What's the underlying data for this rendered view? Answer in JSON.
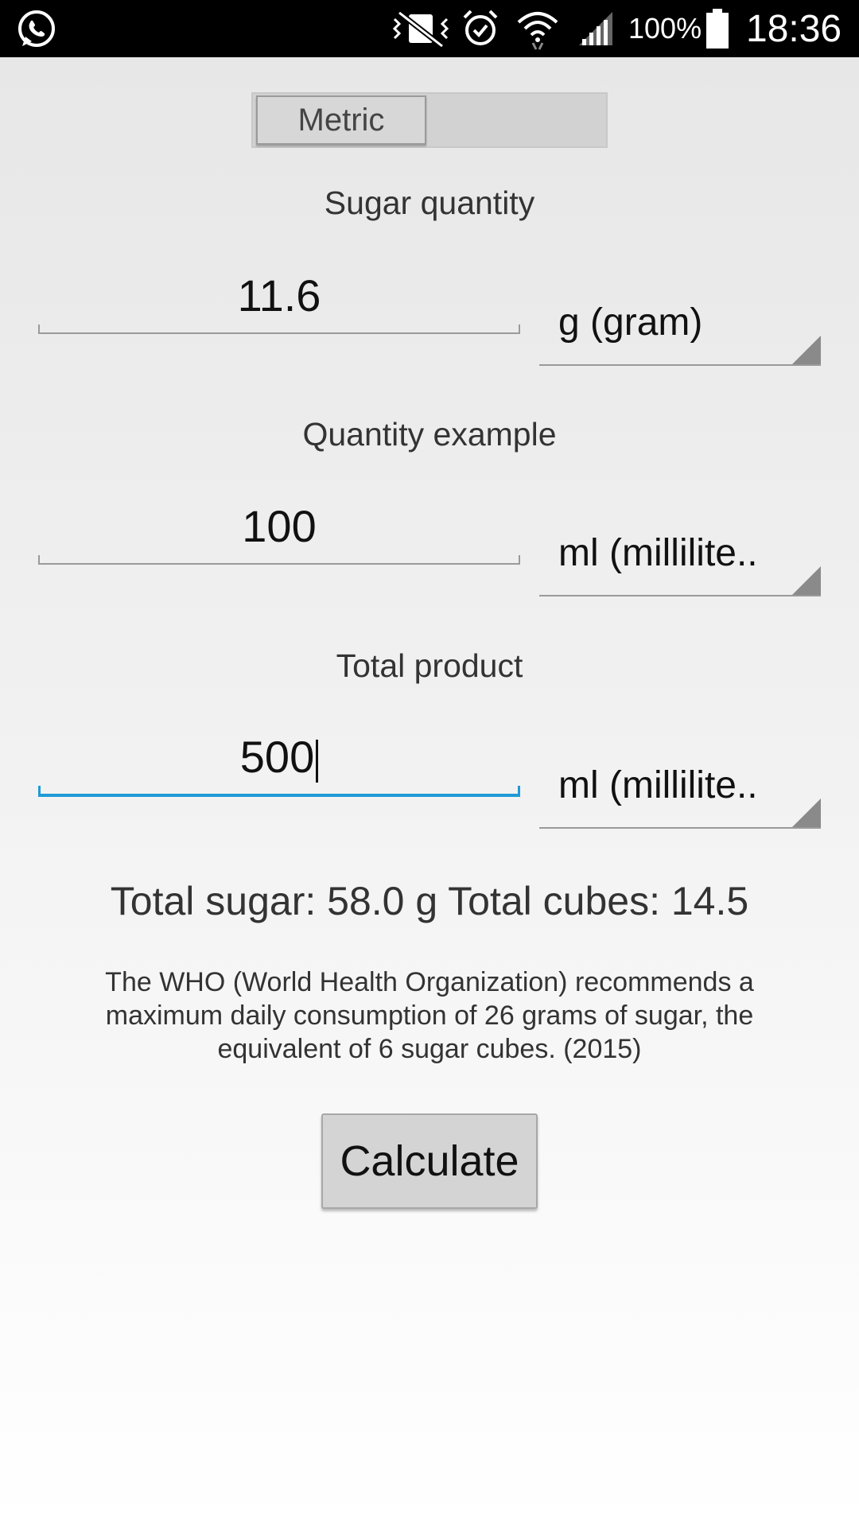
{
  "status_bar": {
    "icons": [
      "whatsapp-icon",
      "vibrate-mute-icon",
      "alarm-icon",
      "wifi-icon",
      "signal-icon",
      "battery-icon"
    ],
    "battery_text": "100%",
    "time": "18:36"
  },
  "toggle": {
    "label": "Metric"
  },
  "sugar": {
    "label": "Sugar quantity",
    "value": "11.6",
    "unit": "g (gram)"
  },
  "example": {
    "label": "Quantity example",
    "value": "100",
    "unit": "ml (millilite.."
  },
  "total": {
    "label": "Total product",
    "value": "500",
    "unit": "ml (millilite.."
  },
  "result": {
    "text": "Total sugar: 58.0 g Total cubes: 14.5"
  },
  "note": {
    "text": "The WHO (World Health Organization) recommends a maximum daily consumption of 26 grams of sugar, the equivalent of 6 sugar cubes. (2015)"
  },
  "calculate_button": {
    "label": "Calculate"
  },
  "colors": {
    "focus_accent": "#1f9bd6",
    "status_bar": "#000000"
  }
}
